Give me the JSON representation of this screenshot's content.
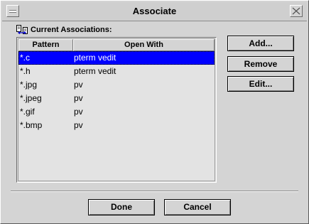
{
  "window": {
    "title": "Associate"
  },
  "section_label": "Current Associations:",
  "table": {
    "columns": [
      "Pattern",
      "Open With"
    ],
    "rows": [
      {
        "pattern": "*.c",
        "open_with": "pterm vedit",
        "selected": true
      },
      {
        "pattern": "*.h",
        "open_with": "pterm vedit",
        "selected": false
      },
      {
        "pattern": "*.jpg",
        "open_with": "pv",
        "selected": false
      },
      {
        "pattern": "*.jpeg",
        "open_with": "pv",
        "selected": false
      },
      {
        "pattern": "*.gif",
        "open_with": "pv",
        "selected": false
      },
      {
        "pattern": "*.bmp",
        "open_with": "pv",
        "selected": false
      }
    ]
  },
  "buttons": {
    "add": "Add...",
    "remove": "Remove",
    "edit": "Edit...",
    "done": "Done",
    "cancel": "Cancel"
  },
  "colors": {
    "selection": "#0000ff",
    "window_bg": "#d4d4d4",
    "list_bg": "#e3e3e3"
  },
  "icons": {
    "menu": "window-menu-icon",
    "close": "close-icon",
    "section": "associations-icon"
  }
}
